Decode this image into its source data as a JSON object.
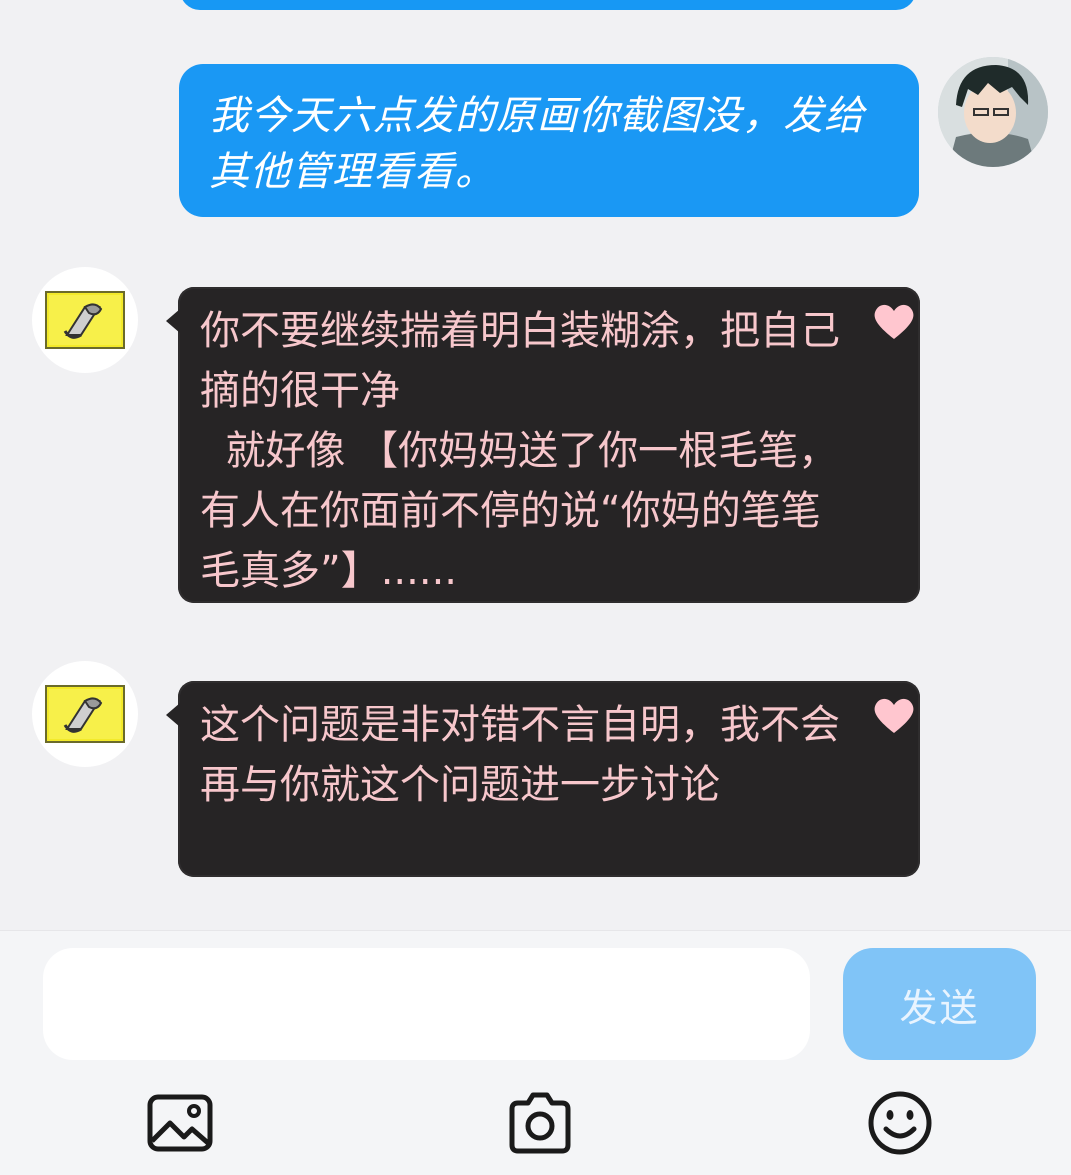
{
  "messages": [
    {
      "direction": "outgoing",
      "text": "我今天六点发的原画你截图没，发给其他管理看看。"
    },
    {
      "direction": "incoming",
      "text": "你不要继续揣着明白装糊涂，把自己摘的很干净\n  就好像 【你妈妈送了你一根毛笔，有人在你面前不停的说“你妈的笔笔毛真多”】......",
      "reaction_icon": "heart-icon"
    },
    {
      "direction": "incoming",
      "text": "这个问题是非对错不言自明，我不会再与你就这个问题进一步讨论",
      "reaction_icon": "heart-icon"
    }
  ],
  "composer": {
    "input_value": "",
    "send_label": "发送"
  },
  "toolbar": [
    {
      "icon": "image-icon"
    },
    {
      "icon": "camera-icon"
    },
    {
      "icon": "emoji-icon"
    }
  ],
  "colors": {
    "outgoing_bubble": "#1a98f4",
    "incoming_bubble": "#262425",
    "incoming_text": "#f7c7cc",
    "send_button": "#80c4f7",
    "heart": "#ffc6cf"
  }
}
